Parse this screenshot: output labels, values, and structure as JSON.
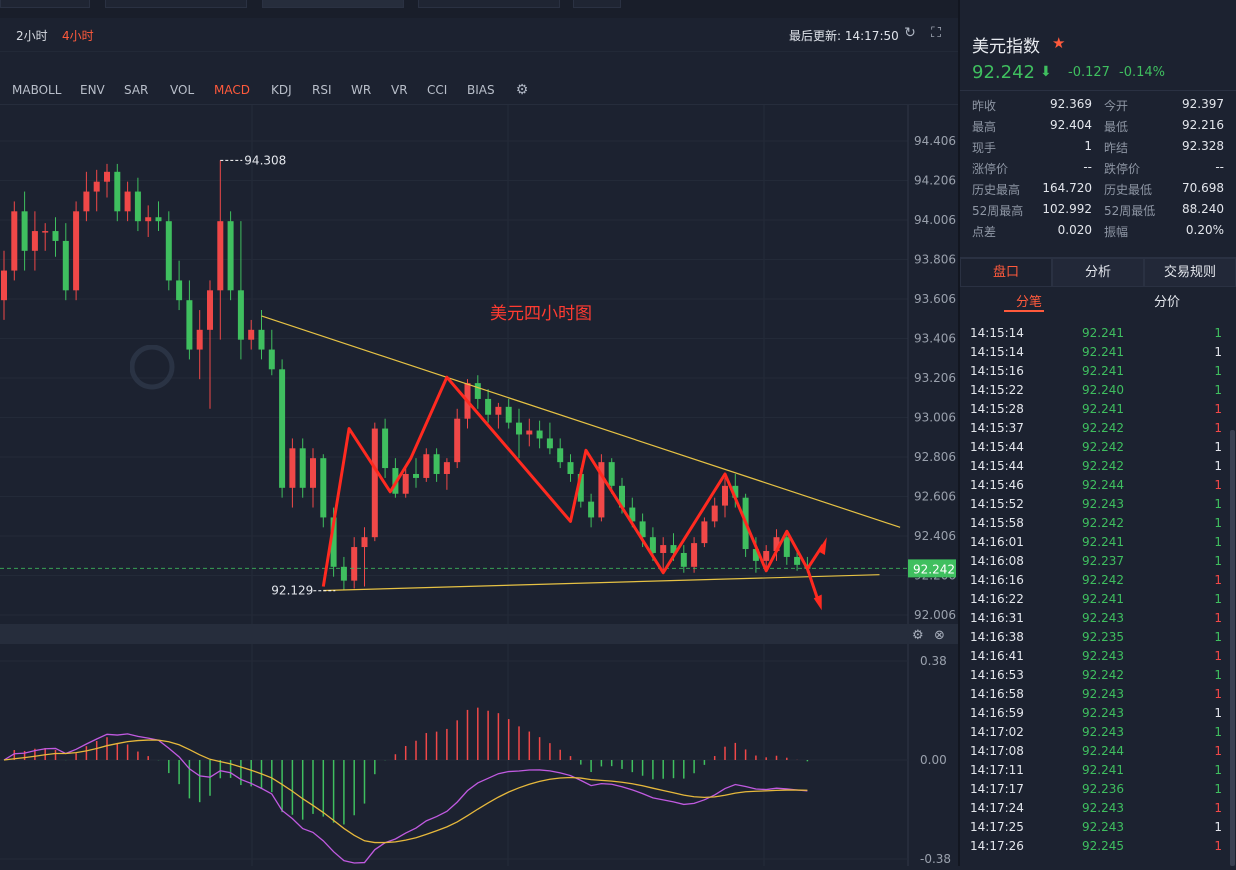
{
  "toolbar": {
    "timeframes": [
      {
        "label": "2小时",
        "active": false
      },
      {
        "label": "4小时",
        "active": true
      }
    ],
    "last_update_label": "最后更新: 14:17:50",
    "refresh_icon": "refresh-icon",
    "fullscreen_icon": "fullscreen-icon"
  },
  "indicators": {
    "items": [
      {
        "label": "MABOLL",
        "active": false
      },
      {
        "label": "ENV",
        "active": false
      },
      {
        "label": "SAR",
        "active": false
      },
      {
        "label": "VOL",
        "active": false
      },
      {
        "label": "MACD",
        "active": true
      },
      {
        "label": "KDJ",
        "active": false
      },
      {
        "label": "RSI",
        "active": false
      },
      {
        "label": "WR",
        "active": false
      },
      {
        "label": "VR",
        "active": false
      },
      {
        "label": "CCI",
        "active": false
      },
      {
        "label": "BIAS",
        "active": false
      }
    ],
    "settings_icon": "gear-icon"
  },
  "chart_data": {
    "type": "candlestick",
    "annotation": "美元四小时图",
    "y_ticks": [
      "94.406",
      "94.206",
      "94.006",
      "93.806",
      "93.606",
      "93.406",
      "93.206",
      "93.006",
      "92.806",
      "92.606",
      "92.406",
      "92.206",
      "92.006"
    ],
    "ylim": [
      92.006,
      94.406
    ],
    "high_marker": {
      "label": "94.308",
      "value": 94.308
    },
    "low_marker": {
      "label": "92.129",
      "value": 92.129
    },
    "current_price": {
      "label": "92.242",
      "value": 92.242
    },
    "candles_ohlc": [
      [
        93.6,
        93.85,
        93.5,
        93.75
      ],
      [
        93.75,
        94.1,
        93.7,
        94.05
      ],
      [
        94.05,
        94.15,
        93.75,
        93.85
      ],
      [
        93.85,
        94.05,
        93.75,
        93.95
      ],
      [
        93.95,
        93.99,
        93.85,
        93.95
      ],
      [
        93.95,
        94.02,
        93.82,
        93.9
      ],
      [
        93.9,
        93.99,
        93.6,
        93.65
      ],
      [
        93.65,
        94.1,
        93.6,
        94.05
      ],
      [
        94.05,
        94.25,
        94.0,
        94.15
      ],
      [
        94.15,
        94.26,
        94.05,
        94.2
      ],
      [
        94.2,
        94.29,
        94.12,
        94.25
      ],
      [
        94.25,
        94.29,
        94.0,
        94.05
      ],
      [
        94.05,
        94.2,
        94.0,
        94.15
      ],
      [
        94.15,
        94.22,
        93.95,
        94.0
      ],
      [
        94.0,
        94.08,
        93.92,
        94.02
      ],
      [
        94.02,
        94.1,
        93.95,
        94.0
      ],
      [
        94.0,
        94.05,
        93.65,
        93.7
      ],
      [
        93.7,
        93.8,
        93.55,
        93.6
      ],
      [
        93.6,
        93.7,
        93.3,
        93.35
      ],
      [
        93.35,
        93.55,
        93.2,
        93.45
      ],
      [
        93.45,
        93.7,
        93.05,
        93.65
      ],
      [
        93.65,
        94.308,
        93.4,
        94.0
      ],
      [
        94.0,
        94.05,
        93.6,
        93.65
      ],
      [
        93.65,
        94.0,
        93.3,
        93.4
      ],
      [
        93.4,
        93.5,
        93.35,
        93.45
      ],
      [
        93.45,
        93.55,
        93.3,
        93.35
      ],
      [
        93.35,
        93.45,
        93.22,
        93.25
      ],
      [
        93.25,
        93.3,
        92.6,
        92.65
      ],
      [
        92.65,
        92.9,
        92.55,
        92.85
      ],
      [
        92.85,
        92.9,
        92.6,
        92.65
      ],
      [
        92.65,
        92.85,
        92.55,
        92.8
      ],
      [
        92.8,
        92.82,
        92.45,
        92.5
      ],
      [
        92.5,
        92.55,
        92.2,
        92.25
      ],
      [
        92.25,
        92.3,
        92.13,
        92.18
      ],
      [
        92.18,
        92.4,
        92.14,
        92.35
      ],
      [
        92.35,
        92.45,
        92.15,
        92.4
      ],
      [
        92.4,
        92.98,
        92.38,
        92.95
      ],
      [
        92.95,
        93.0,
        92.7,
        92.75
      ],
      [
        92.75,
        92.8,
        92.6,
        92.62
      ],
      [
        92.62,
        92.75,
        92.6,
        92.72
      ],
      [
        92.72,
        92.8,
        92.65,
        92.7
      ],
      [
        92.7,
        92.85,
        92.68,
        92.82
      ],
      [
        92.82,
        92.85,
        92.68,
        92.72
      ],
      [
        92.72,
        92.8,
        92.64,
        92.78
      ],
      [
        92.78,
        93.05,
        92.75,
        93.0
      ],
      [
        93.0,
        93.2,
        92.95,
        93.18
      ],
      [
        93.18,
        93.22,
        93.05,
        93.1
      ],
      [
        93.1,
        93.15,
        92.98,
        93.02
      ],
      [
        93.02,
        93.08,
        92.95,
        93.06
      ],
      [
        93.06,
        93.1,
        92.95,
        92.98
      ],
      [
        92.98,
        93.05,
        92.8,
        92.92
      ],
      [
        92.92,
        93.0,
        92.86,
        92.94
      ],
      [
        92.94,
        92.99,
        92.85,
        92.9
      ],
      [
        92.9,
        92.98,
        92.82,
        92.85
      ],
      [
        92.85,
        92.9,
        92.75,
        92.78
      ],
      [
        92.78,
        92.82,
        92.68,
        92.72
      ],
      [
        92.72,
        92.75,
        92.55,
        92.58
      ],
      [
        92.58,
        92.62,
        92.45,
        92.5
      ],
      [
        92.5,
        92.82,
        92.48,
        92.78
      ],
      [
        92.78,
        92.8,
        92.62,
        92.66
      ],
      [
        92.66,
        92.7,
        92.52,
        92.55
      ],
      [
        92.55,
        92.6,
        92.45,
        92.48
      ],
      [
        92.48,
        92.52,
        92.35,
        92.4
      ],
      [
        92.4,
        92.45,
        92.28,
        92.32
      ],
      [
        92.32,
        92.4,
        92.22,
        92.36
      ],
      [
        92.36,
        92.42,
        92.28,
        92.32
      ],
      [
        92.32,
        92.36,
        92.22,
        92.25
      ],
      [
        92.25,
        92.4,
        92.22,
        92.37
      ],
      [
        92.37,
        92.5,
        92.35,
        92.48
      ],
      [
        92.48,
        92.6,
        92.45,
        92.56
      ],
      [
        92.56,
        92.7,
        92.5,
        92.66
      ],
      [
        92.66,
        92.72,
        92.55,
        92.6
      ],
      [
        92.6,
        92.62,
        92.3,
        92.34
      ],
      [
        92.34,
        92.4,
        92.22,
        92.28
      ],
      [
        92.28,
        92.36,
        92.24,
        92.33
      ],
      [
        92.33,
        92.44,
        92.28,
        92.4
      ],
      [
        92.4,
        92.42,
        92.26,
        92.3
      ],
      [
        92.3,
        92.34,
        92.23,
        92.26
      ],
      [
        92.26,
        92.3,
        92.22,
        92.24
      ]
    ]
  },
  "macd_panel": {
    "y_ticks": [
      "0.38",
      "0.00",
      "-0.38"
    ],
    "ylim": [
      -0.38,
      0.38
    ],
    "settings_icon": "gear-icon",
    "close_icon": "close-icon"
  },
  "quote": {
    "name": "美元指数",
    "price": "92.242",
    "change": "-0.127",
    "change_pct": "-0.14%",
    "rows": [
      {
        "l1": "昨收",
        "v1": "92.369",
        "l2": "今开",
        "v2": "92.397",
        "c1": "#e3e6ec",
        "c2": "#e3e6ec"
      },
      {
        "l1": "最高",
        "v1": "92.404",
        "l2": "最低",
        "v2": "92.216",
        "c1": "#e3e6ec",
        "c2": "#e3e6ec"
      },
      {
        "l1": "现手",
        "v1": "1",
        "l2": "昨结",
        "v2": "92.328",
        "c1": "#e3e6ec",
        "c2": "#e3e6ec"
      },
      {
        "l1": "涨停价",
        "v1": "--",
        "l2": "跌停价",
        "v2": "--",
        "c1": "#e3e6ec",
        "c2": "#e3e6ec"
      },
      {
        "l1": "历史最高",
        "v1": "164.720",
        "l2": "历史最低",
        "v2": "70.698",
        "c1": "#e3e6ec",
        "c2": "#e3e6ec"
      },
      {
        "l1": "52周最高",
        "v1": "102.992",
        "l2": "52周最低",
        "v2": "88.240",
        "c1": "#e3e6ec",
        "c2": "#e3e6ec"
      },
      {
        "l1": "点差",
        "v1": "0.020",
        "l2": "振幅",
        "v2": "0.20%",
        "c1": "#e3e6ec",
        "c2": "#e3e6ec"
      }
    ]
  },
  "tabs": [
    {
      "label": "盘口",
      "active": true
    },
    {
      "label": "分析",
      "active": false
    },
    {
      "label": "交易规则",
      "active": false
    }
  ],
  "subtabs": [
    {
      "label": "分笔",
      "active": true
    },
    {
      "label": "分价",
      "active": false
    }
  ],
  "trades": [
    {
      "time": "14:15:14",
      "price": "92.241",
      "vol": "1",
      "dir": "up"
    },
    {
      "time": "14:15:14",
      "price": "92.241",
      "vol": "1",
      "dir": "same"
    },
    {
      "time": "14:15:16",
      "price": "92.241",
      "vol": "1",
      "dir": "up"
    },
    {
      "time": "14:15:22",
      "price": "92.240",
      "vol": "1",
      "dir": "up"
    },
    {
      "time": "14:15:28",
      "price": "92.241",
      "vol": "1",
      "dir": "down"
    },
    {
      "time": "14:15:37",
      "price": "92.242",
      "vol": "1",
      "dir": "down"
    },
    {
      "time": "14:15:44",
      "price": "92.242",
      "vol": "1",
      "dir": "same"
    },
    {
      "time": "14:15:44",
      "price": "92.242",
      "vol": "1",
      "dir": "same"
    },
    {
      "time": "14:15:46",
      "price": "92.244",
      "vol": "1",
      "dir": "down"
    },
    {
      "time": "14:15:52",
      "price": "92.243",
      "vol": "1",
      "dir": "up"
    },
    {
      "time": "14:15:58",
      "price": "92.242",
      "vol": "1",
      "dir": "up"
    },
    {
      "time": "14:16:01",
      "price": "92.241",
      "vol": "1",
      "dir": "up"
    },
    {
      "time": "14:16:08",
      "price": "92.237",
      "vol": "1",
      "dir": "up"
    },
    {
      "time": "14:16:16",
      "price": "92.242",
      "vol": "1",
      "dir": "down"
    },
    {
      "time": "14:16:22",
      "price": "92.241",
      "vol": "1",
      "dir": "up"
    },
    {
      "time": "14:16:31",
      "price": "92.243",
      "vol": "1",
      "dir": "down"
    },
    {
      "time": "14:16:38",
      "price": "92.235",
      "vol": "1",
      "dir": "up"
    },
    {
      "time": "14:16:41",
      "price": "92.243",
      "vol": "1",
      "dir": "down"
    },
    {
      "time": "14:16:53",
      "price": "92.242",
      "vol": "1",
      "dir": "up"
    },
    {
      "time": "14:16:58",
      "price": "92.243",
      "vol": "1",
      "dir": "down"
    },
    {
      "time": "14:16:59",
      "price": "92.243",
      "vol": "1",
      "dir": "same"
    },
    {
      "time": "14:17:02",
      "price": "92.243",
      "vol": "1",
      "dir": "up"
    },
    {
      "time": "14:17:08",
      "price": "92.244",
      "vol": "1",
      "dir": "down"
    },
    {
      "time": "14:17:11",
      "price": "92.241",
      "vol": "1",
      "dir": "up"
    },
    {
      "time": "14:17:17",
      "price": "92.236",
      "vol": "1",
      "dir": "up"
    },
    {
      "time": "14:17:24",
      "price": "92.243",
      "vol": "1",
      "dir": "down"
    },
    {
      "time": "14:17:25",
      "price": "92.243",
      "vol": "1",
      "dir": "same"
    },
    {
      "time": "14:17:26",
      "price": "92.245",
      "vol": "1",
      "dir": "down"
    }
  ],
  "colors": {
    "up": "#f04848",
    "down": "#3fbf5f",
    "accent": "#ff5a3c",
    "trend": "#e6c244"
  }
}
